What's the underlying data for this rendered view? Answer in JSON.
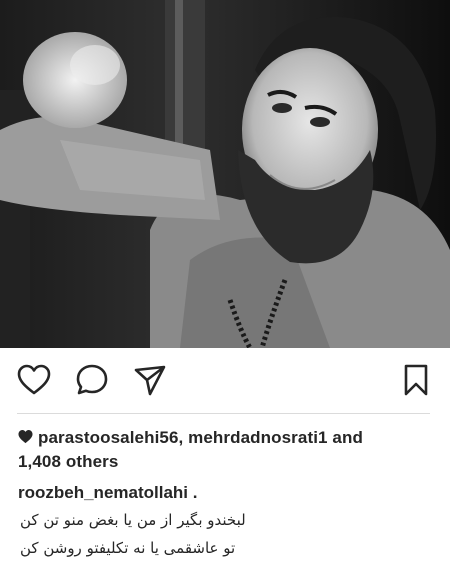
{
  "post": {
    "image_alt": "black and white portrait of bearded man raising fist",
    "actions": {
      "like_icon": "heart-outline-icon",
      "comment_icon": "comment-bubble-icon",
      "share_icon": "paper-plane-icon",
      "save_icon": "bookmark-icon"
    },
    "likes": {
      "icon": "heart-filled-icon",
      "user1": "parastoosalehi56",
      "sep": ",",
      "user2": "mehrdadnosrati1",
      "and_text": "and",
      "others": "1,408 others"
    },
    "caption": {
      "username": "roozbeh_nematollahi",
      "dot": ".",
      "line1": "لبخندو بگیر از من یا بغض منو تن کن",
      "line2": "تو عاشقمی یا نه تکلیفتو روشن کن"
    }
  }
}
